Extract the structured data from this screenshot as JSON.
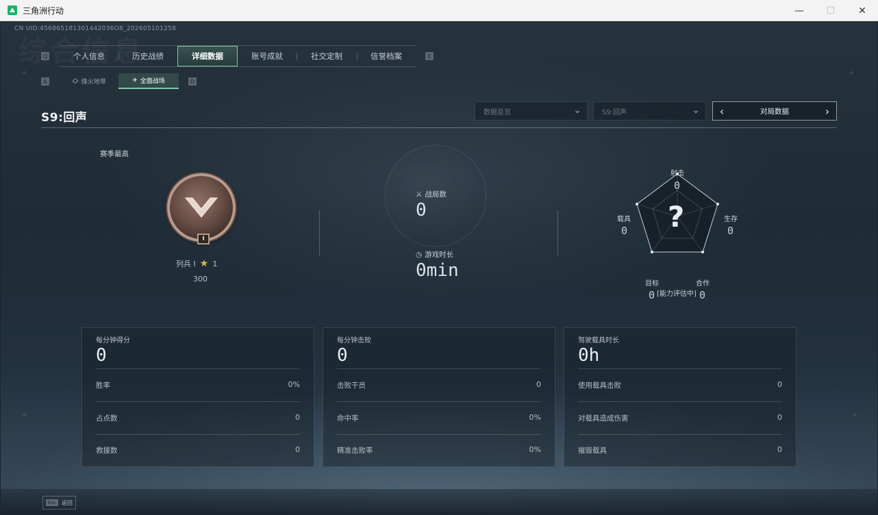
{
  "window": {
    "title": "三角洲行动",
    "controls": {
      "minimize": "—",
      "maximize": "☐",
      "close": "✕"
    }
  },
  "header": {
    "uid": "CN UID:456865181301442036O8_202605101258",
    "watermark": "综合信息"
  },
  "tabs": [
    {
      "label": "个人信息",
      "active": false
    },
    {
      "label": "历史战绩",
      "active": false
    },
    {
      "label": "详细数据",
      "active": true
    },
    {
      "label": "账号成就",
      "active": false
    },
    {
      "label": "社交定制",
      "active": false
    },
    {
      "label": "信誉档案",
      "active": false
    }
  ],
  "tab_hints": {
    "left": "Q",
    "right": "E"
  },
  "subtabs": [
    {
      "label": "烽火地带",
      "active": false
    },
    {
      "label": "全面战场",
      "active": true
    }
  ],
  "subtab_hints": {
    "left": "A",
    "right": "D"
  },
  "season": {
    "title": "S9:回声"
  },
  "filters": {
    "overview": "数据总览",
    "season": "S9:回声",
    "pager_label": "对局数据"
  },
  "best": {
    "label": "赛季最高",
    "rank_name": "列兵 I",
    "stars": "1",
    "score": "300",
    "badge_numeral": "I"
  },
  "middle": {
    "matches_label": "战局数",
    "matches_value": "0",
    "time_label": "游戏时长",
    "time_value": "0min"
  },
  "radar": {
    "center": "?",
    "status": "[能力评估中]",
    "axes": [
      {
        "label": "射击",
        "value": "0"
      },
      {
        "label": "生存",
        "value": "0"
      },
      {
        "label": "合作",
        "value": "0"
      },
      {
        "label": "目标",
        "value": "0"
      },
      {
        "label": "载具",
        "value": "0"
      }
    ]
  },
  "cards": [
    {
      "title": "每分钟得分",
      "big": "0",
      "rows": [
        {
          "label": "胜率",
          "value": "0%"
        },
        {
          "label": "占点数",
          "value": "0"
        },
        {
          "label": "救援数",
          "value": "0"
        }
      ]
    },
    {
      "title": "每分钟击败",
      "big": "0",
      "rows": [
        {
          "label": "击败干员",
          "value": "0"
        },
        {
          "label": "命中率",
          "value": "0%"
        },
        {
          "label": "精准击败率",
          "value": "0%"
        }
      ]
    },
    {
      "title": "驾驶载具时长",
      "big": "0h",
      "rows": [
        {
          "label": "使用载具击败",
          "value": "0"
        },
        {
          "label": "对载具造成伤害",
          "value": "0"
        },
        {
          "label": "摧毁载具",
          "value": "0"
        }
      ]
    }
  ],
  "footer": {
    "esc_key": "Esc",
    "esc_label": "返回"
  },
  "colors": {
    "accent": "#7fc8a9",
    "background": "#1f2b35",
    "star": "#d9b94c",
    "app_icon": "#17b26a"
  }
}
